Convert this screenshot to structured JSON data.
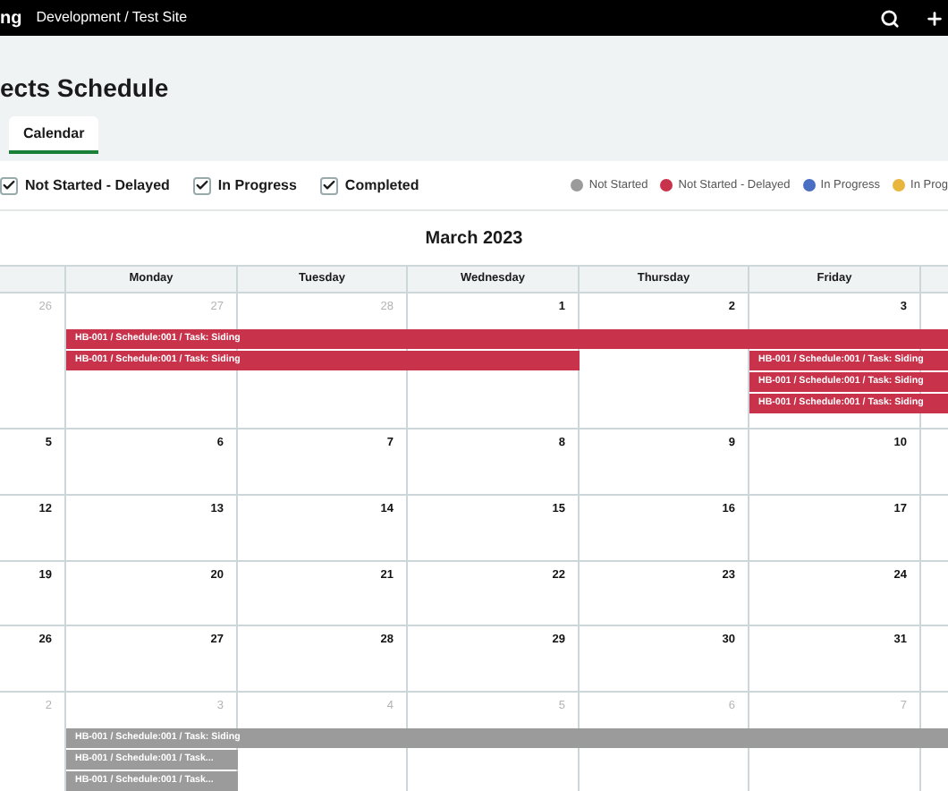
{
  "topbar": {
    "brand": "ng",
    "breadcrumb": "Development / Test Site"
  },
  "page": {
    "title": "ects Schedule"
  },
  "tabs": [
    {
      "label": "Calendar",
      "selected": true
    }
  ],
  "filters": [
    {
      "label": "Not Started - Delayed",
      "checked": true
    },
    {
      "label": "In Progress",
      "checked": true
    },
    {
      "label": "Completed",
      "checked": true
    }
  ],
  "legend": [
    {
      "label": "Not Started",
      "color": "#9b9b9b"
    },
    {
      "label": "Not Started - Delayed",
      "color": "#c8334b"
    },
    {
      "label": "In Progress",
      "color": "#4a6ec2"
    },
    {
      "label": "In Prog",
      "color": "#e8b53d"
    }
  ],
  "calendar": {
    "month": "March 2023",
    "columns": [
      "Monday",
      "Tuesday",
      "Wednesday",
      "Thursday",
      "Friday"
    ],
    "weeks": [
      {
        "days": [
          {
            "date": "26",
            "muted": true
          },
          {
            "date": "27",
            "muted": true
          },
          {
            "date": "28",
            "muted": true
          },
          {
            "date": "1",
            "muted": false
          },
          {
            "date": "2",
            "muted": false
          },
          {
            "date": "3",
            "muted": false
          }
        ],
        "lanes": [
          [
            {
              "kind": "gap"
            },
            {
              "kind": "start",
              "label": "HB-001 / Schedule:001 / Task: Siding",
              "color": "#c8334b"
            },
            {
              "kind": "continued"
            },
            {
              "kind": "continued"
            },
            {
              "kind": "continued"
            },
            {
              "kind": "continued"
            },
            {
              "kind": "continued"
            }
          ],
          [
            {
              "kind": "gap"
            },
            {
              "kind": "start",
              "label": "HB-001 / Schedule:001 / Task: Siding",
              "color": "#c8334b"
            },
            {
              "kind": "continued"
            },
            {
              "kind": "continued"
            },
            {
              "kind": "gap"
            },
            {
              "kind": "start",
              "label": "HB-001 / Schedule:001 / Task: Siding",
              "color": "#c8334b"
            },
            {
              "kind": "continued"
            }
          ],
          [
            {
              "kind": "gap"
            },
            {
              "kind": "gap"
            },
            {
              "kind": "gap"
            },
            {
              "kind": "gap"
            },
            {
              "kind": "gap"
            },
            {
              "kind": "start",
              "label": "HB-001 / Schedule:001 / Task: Siding",
              "color": "#c8334b"
            },
            {
              "kind": "continued"
            }
          ],
          [
            {
              "kind": "gap"
            },
            {
              "kind": "gap"
            },
            {
              "kind": "gap"
            },
            {
              "kind": "gap"
            },
            {
              "kind": "gap"
            },
            {
              "kind": "start",
              "label": "HB-001 / Schedule:001 / Task: Siding",
              "color": "#c8334b"
            },
            {
              "kind": "continued"
            }
          ]
        ]
      },
      {
        "days": [
          {
            "date": "5",
            "muted": false
          },
          {
            "date": "6",
            "muted": false
          },
          {
            "date": "7",
            "muted": false
          },
          {
            "date": "8",
            "muted": false
          },
          {
            "date": "9",
            "muted": false
          },
          {
            "date": "10",
            "muted": false
          }
        ]
      },
      {
        "days": [
          {
            "date": "12",
            "muted": false
          },
          {
            "date": "13",
            "muted": false
          },
          {
            "date": "14",
            "muted": false
          },
          {
            "date": "15",
            "muted": false
          },
          {
            "date": "16",
            "muted": false
          },
          {
            "date": "17",
            "muted": false
          }
        ]
      },
      {
        "days": [
          {
            "date": "19",
            "muted": false
          },
          {
            "date": "20",
            "muted": false
          },
          {
            "date": "21",
            "muted": false
          },
          {
            "date": "22",
            "muted": false
          },
          {
            "date": "23",
            "muted": false
          },
          {
            "date": "24",
            "muted": false
          }
        ]
      },
      {
        "days": [
          {
            "date": "26",
            "muted": false
          },
          {
            "date": "27",
            "muted": false
          },
          {
            "date": "28",
            "muted": false
          },
          {
            "date": "29",
            "muted": false
          },
          {
            "date": "30",
            "muted": false
          },
          {
            "date": "31",
            "muted": false
          }
        ]
      },
      {
        "days": [
          {
            "date": "2",
            "muted": true
          },
          {
            "date": "3",
            "muted": true
          },
          {
            "date": "4",
            "muted": true
          },
          {
            "date": "5",
            "muted": true
          },
          {
            "date": "6",
            "muted": true
          },
          {
            "date": "7",
            "muted": true
          }
        ],
        "lanes": [
          [
            {
              "kind": "gap"
            },
            {
              "kind": "start",
              "label": "HB-001 / Schedule:001 / Task: Siding",
              "color": "#9b9b9b"
            },
            {
              "kind": "continued"
            },
            {
              "kind": "continued"
            },
            {
              "kind": "continued"
            },
            {
              "kind": "continued"
            },
            {
              "kind": "continued"
            }
          ],
          [
            {
              "kind": "gap"
            },
            {
              "kind": "start",
              "label": "HB-001 / Schedule:001 / Task...",
              "color": "#9b9b9b"
            }
          ],
          [
            {
              "kind": "gap"
            },
            {
              "kind": "start",
              "label": "HB-001 / Schedule:001 / Task...",
              "color": "#9b9b9b"
            }
          ]
        ]
      }
    ]
  }
}
